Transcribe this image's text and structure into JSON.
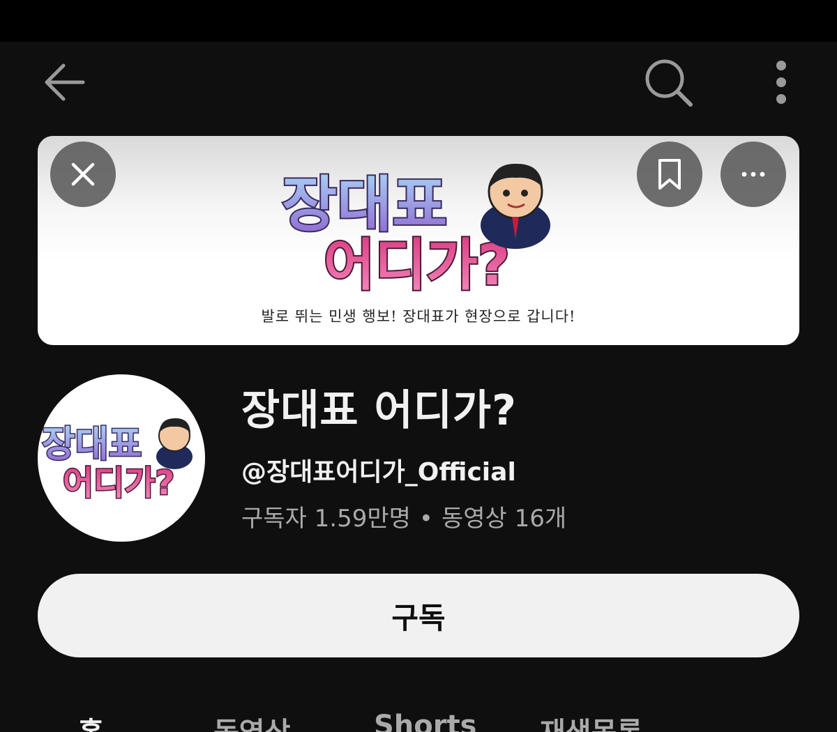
{
  "icons": {
    "back": "arrow-left-icon",
    "search": "search-icon",
    "more": "vertical-ellipsis-icon",
    "banner_close": "close-icon",
    "banner_bookmark": "bookmark-icon",
    "banner_more": "horizontal-ellipsis-icon"
  },
  "banner": {
    "logo_line1": "장대표",
    "logo_line2": "어디가?",
    "tagline": "발로 뛰는 민생 행보! 장대표가 현장으로 갑니다!"
  },
  "channel": {
    "name": "장대표 어디가?",
    "handle": "@장대표어디가_Official",
    "subscribers": "구독자 1.59만명",
    "separator": "•",
    "videos": "동영상 16개"
  },
  "subscribe_button": "구독",
  "tabs": [
    "홈",
    "동영상",
    "Shorts",
    "재생목록"
  ],
  "colors": {
    "background": "#0f0f0f",
    "text_primary": "#f1f1f1",
    "text_secondary": "#aaaaaa",
    "logo_top_gradient": [
      "#9ec9f0",
      "#9a6fd6"
    ],
    "logo_bottom_gradient": [
      "#e14a8c",
      "#f07ab5"
    ]
  }
}
